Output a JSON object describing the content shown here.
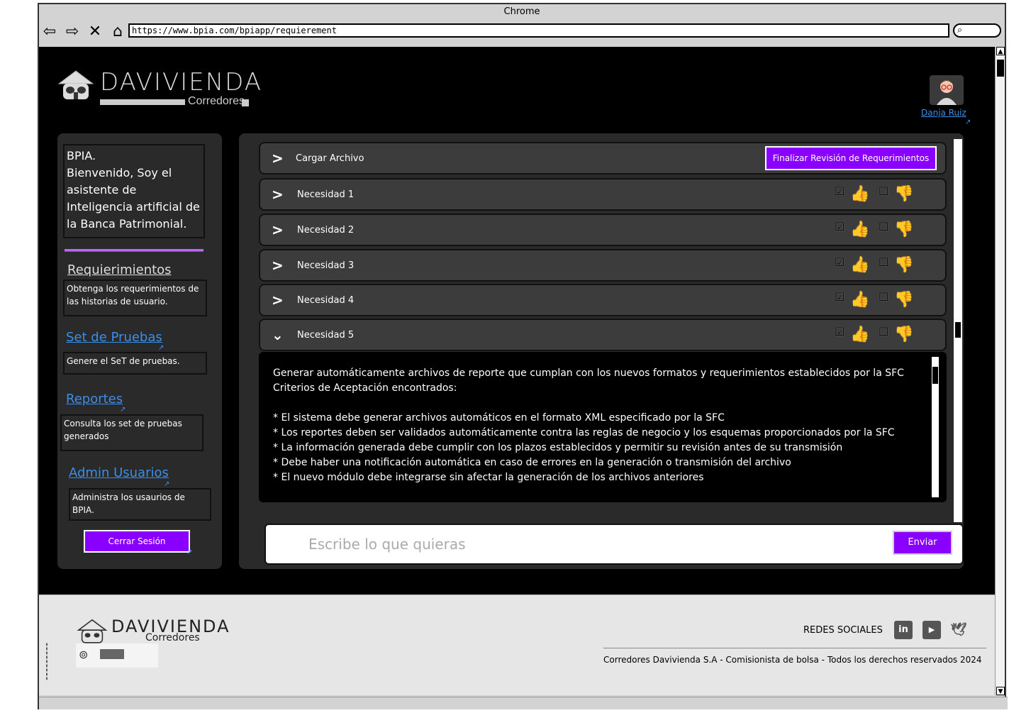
{
  "browser": {
    "title": "Chrome",
    "url": "https://www.bpia.com/bpiapp/requierement",
    "nav": {
      "back": "⇦",
      "forward": "⇨",
      "stop": "✕",
      "home": "⌂",
      "search": "🔍"
    }
  },
  "header": {
    "brand_name": "DAVIVIENDA",
    "brand_sub": "Corredores",
    "user_name": "Danja Ruiz"
  },
  "sidebar": {
    "intro": "BPIA.\nBienvenido, Soy el asistente de Inteligencia artificial de la Banca Patrimonial.",
    "links": [
      {
        "label": "Requierimientos",
        "desc": "Obtenga los requerimientos de las historias de usuario."
      },
      {
        "label": "Set de Pruebas",
        "desc": "Genere el SeT de pruebas."
      },
      {
        "label": "Reportes",
        "desc": "Consulta los set de pruebas generados"
      },
      {
        "label": "Admin Usuarios",
        "desc": "Administra los usaurios de BPIA."
      }
    ],
    "logout": "Cerrar Sesión",
    "accent": "#8a00ff"
  },
  "main": {
    "upload_label": "Cargar Archivo",
    "finalize_label": "Finalizar Revisión de Requerimientos",
    "needs": [
      {
        "label": "Necesidad 1",
        "expanded": false
      },
      {
        "label": "Necesidad 2",
        "expanded": false
      },
      {
        "label": "Necesidad 3",
        "expanded": false
      },
      {
        "label": "Necesidad 4",
        "expanded": false
      },
      {
        "label": "Necesidad 5",
        "expanded": true
      }
    ],
    "detail": {
      "line1": "Generar automáticamente archivos de reporte que cumplan con los nuevos formatos y requerimientos establecidos por la SFC",
      "line2": "Criterios de Aceptación encontrados:",
      "criteria": [
        "* El sistema debe generar archivos automáticos en el formato XML especificado por la SFC",
        "* Los reportes deben ser validados automáticamente contra las reglas de negocio y los esquemas proporcionados por la SFC",
        "* La información generada debe cumplir con los plazos establecidos y permitir su revisión antes de su transmisión",
        "* Debe haber una notificación automática en caso de errores en la generación o transmisión del archivo",
        "* El nuevo módulo debe integrarse sin afectar la generación de los archivos anteriores"
      ]
    },
    "chat": {
      "placeholder": "Escribe lo que quieras",
      "send": "Enviar"
    }
  },
  "footer": {
    "brand_name": "DAVIVIENDA",
    "brand_sub": "Corredores",
    "social_label": "REDES SOCIALES",
    "social": [
      {
        "name": "linkedin-icon",
        "glyph": "in",
        "color": "#555555"
      },
      {
        "name": "youtube-icon",
        "glyph": "▶",
        "color": "#555555"
      },
      {
        "name": "twitter-icon",
        "glyph": "🐦",
        "color": "#e6e6e6"
      }
    ],
    "copyright": "Corredores Davivienda S.A - Comisionista de bolsa - Todos los derechos reservados 2024"
  }
}
